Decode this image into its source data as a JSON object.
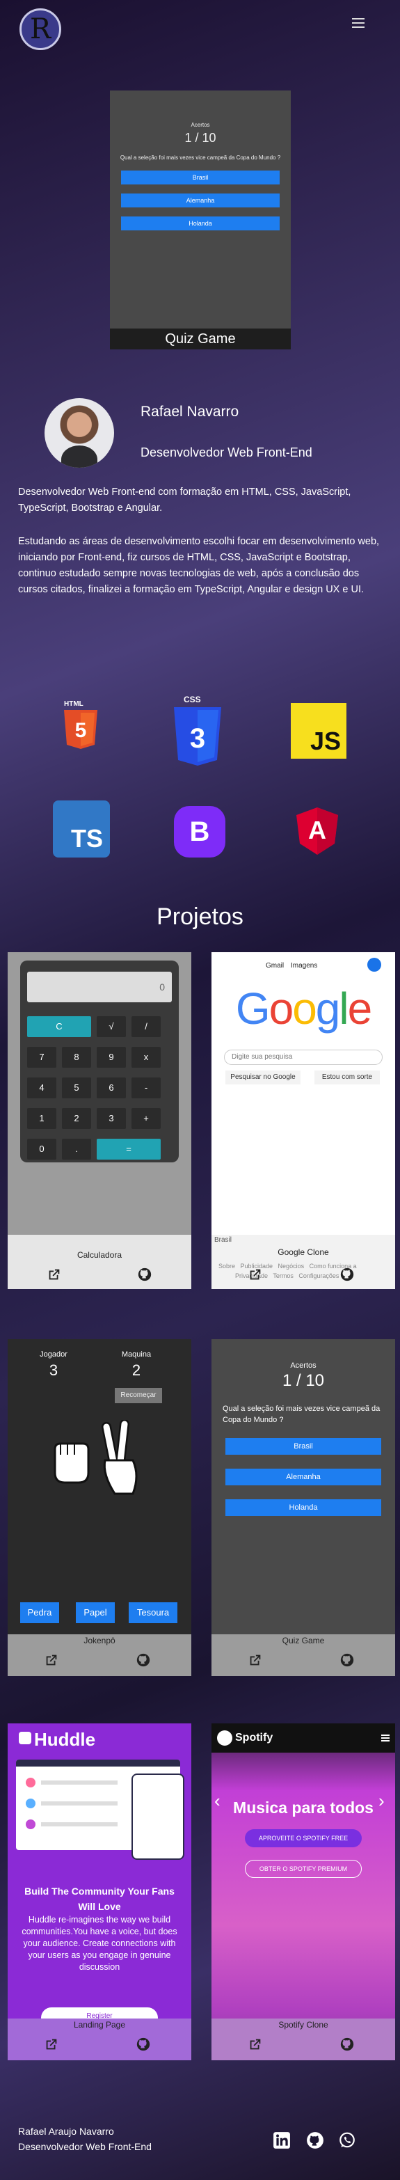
{
  "header": {
    "logo_letter": "R"
  },
  "hero": {
    "score_label": "Acertos",
    "score": "1 / 10",
    "question": "Qual a seleção foi mais vezes vice campeã da Copa do Mundo ?",
    "options": [
      "Brasil",
      "Alemanha",
      "Holanda"
    ],
    "caption": "Quiz Game"
  },
  "profile": {
    "name": "Rafael Navarro",
    "role": "Desenvolvedor Web Front-End",
    "bio1": "Desenvolvedor Web Front-end com formação em HTML, CSS, JavaScript, TypeScript, Bootstrap e Angular.",
    "bio2": "Estudando as áreas de desenvolvimento escolhi focar em desenvolvimento web, iniciando por Front-end, fiz cursos de HTML, CSS, JavaScript e Bootstrap, continuo estudado sempre novas tecnologias de web, após a conclusão dos cursos citados, finalizei a formação em TypeScript, Angular e design UX e UI."
  },
  "tech": {
    "html": "HTML",
    "css": "CSS",
    "js": "JS",
    "ts": "TS",
    "bootstrap": "B",
    "angular": "A"
  },
  "projects": {
    "title": "Projetos",
    "calculator": {
      "caption": "Calculadora",
      "display": "0",
      "keys": [
        "C",
        "√",
        "/",
        "7",
        "8",
        "9",
        "x",
        "4",
        "5",
        "6",
        "-",
        "1",
        "2",
        "3",
        "+",
        "0",
        ".",
        "="
      ]
    },
    "google": {
      "caption": "Google Clone",
      "links": [
        "Gmail",
        "Imagens"
      ],
      "logo": [
        "G",
        "o",
        "o",
        "g",
        "l",
        "e"
      ],
      "search_placeholder": "Digite sua pesquisa",
      "btn_search": "Pesquisar no Google",
      "btn_lucky": "Estou com sorte",
      "country": "Brasil",
      "footer1": "Sobre   Publicidade   Negócios   Como funciona a",
      "footer2": "Privacidade   Termos   Configurações"
    },
    "jokenpo": {
      "caption": "Jokenpô",
      "player_label": "Jogador",
      "player_score": "3",
      "machine_label": "Maquina",
      "machine_score": "2",
      "restart": "Recomeçar",
      "buttons": [
        "Pedra",
        "Papel",
        "Tesoura"
      ]
    },
    "quiz": {
      "caption": "Quiz Game",
      "score_label": "Acertos",
      "score": "1 / 10",
      "question": "Qual a seleção foi mais vezes vice campeã da Copa do Mundo ?",
      "options": [
        "Brasil",
        "Alemanha",
        "Holanda"
      ]
    },
    "huddle": {
      "caption": "Landing Page",
      "brand": "Huddle",
      "headline": "Build The Community Your Fans Will Love",
      "text": "Huddle re-imagines the way we build communities.You have a voice, but does your audience. Create connections with your users as you engage in genuine discussion",
      "button": "Register"
    },
    "spotify": {
      "caption": "Spotify Clone",
      "brand": "Spotify",
      "headline": "Musica para todos",
      "btn_free": "APROVEITE O SPOTIFY FREE",
      "btn_premium": "OBTER O SPOTIFY PREMIUM"
    }
  },
  "footer": {
    "name": "Rafael Araujo Navarro",
    "role": "Desenvolvedor Web Front-End"
  },
  "colors": {
    "accent_blue": "#1e7ef0",
    "calc_teal": "#21a3b3",
    "html_orange": "#e44d26",
    "css_blue": "#264de4",
    "js_yellow": "#f7df1e",
    "ts_blue": "#3178c6",
    "bootstrap_purple": "#7e2cf8",
    "angular_red": "#dd0031",
    "huddle_purple": "#8b2ad6",
    "spotify_pink": "#c23fd6"
  }
}
